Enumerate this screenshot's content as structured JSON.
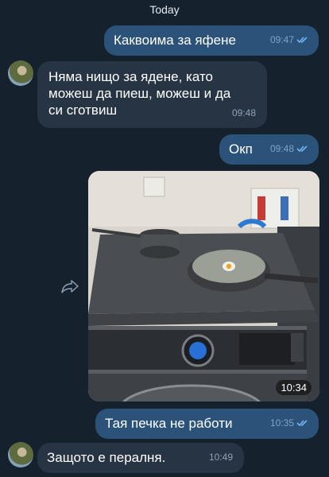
{
  "date_separator": "Today",
  "messages": [
    {
      "text": "Каквоима за яфене",
      "time": "09:47",
      "direction": "out"
    },
    {
      "text": "Няма нищо за ядене, като можеш да пиеш, можеш и да си сготвиш",
      "time": "09:48",
      "direction": "in"
    },
    {
      "text": "Окп",
      "time": "09:48",
      "direction": "out"
    },
    {
      "time": "10:34",
      "direction": "out",
      "type": "photo"
    },
    {
      "text": "Тая печка не работи",
      "time": "10:35",
      "direction": "out"
    },
    {
      "text": "Защото е пералня.",
      "time": "10:49",
      "direction": "in"
    }
  ],
  "colors": {
    "background": "#16212e",
    "outgoing_bubble": "#2b5278",
    "incoming_bubble": "#263443",
    "read_ticks": "#72b6f5"
  },
  "icons": {
    "read_status": "double-check-icon",
    "share": "share-icon"
  }
}
